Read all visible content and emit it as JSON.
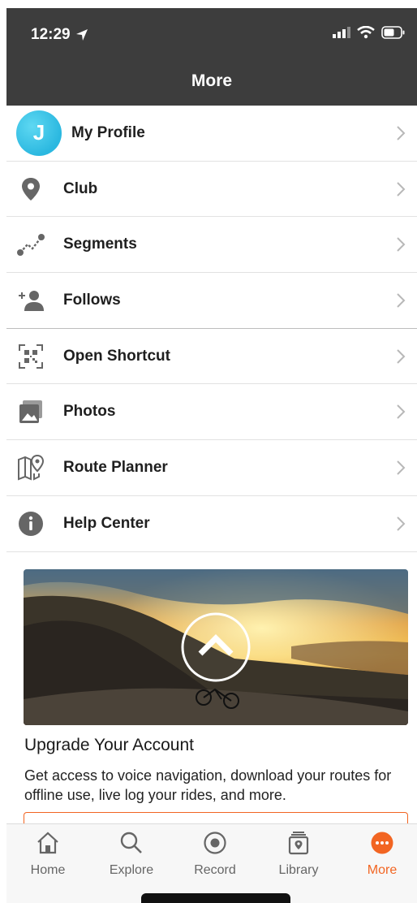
{
  "status": {
    "time": "12:29"
  },
  "header": {
    "title": "More"
  },
  "profile": {
    "avatar_letter": "J",
    "label": "My Profile"
  },
  "menu": [
    {
      "label": "Club",
      "icon": "location-pin-icon"
    },
    {
      "label": "Segments",
      "icon": "segments-icon"
    },
    {
      "label": "Follows",
      "icon": "add-person-icon"
    },
    {
      "label": "Open Shortcut",
      "icon": "qr-code-icon"
    },
    {
      "label": "Photos",
      "icon": "photos-icon"
    },
    {
      "label": "Route Planner",
      "icon": "map-pin-icon"
    },
    {
      "label": "Help Center",
      "icon": "info-icon"
    }
  ],
  "promo": {
    "title": "Upgrade Your Account",
    "text": "Get access to voice navigation, download your routes for offline use, live log your rides, and more."
  },
  "tabs": [
    {
      "label": "Home",
      "icon": "home-icon"
    },
    {
      "label": "Explore",
      "icon": "search-icon"
    },
    {
      "label": "Record",
      "icon": "record-icon"
    },
    {
      "label": "Library",
      "icon": "library-icon"
    },
    {
      "label": "More",
      "icon": "more-icon",
      "active": true
    }
  ],
  "colors": {
    "accent": "#f26522",
    "header_bg": "#3d3d3d",
    "avatar": "#2bb8e0"
  }
}
